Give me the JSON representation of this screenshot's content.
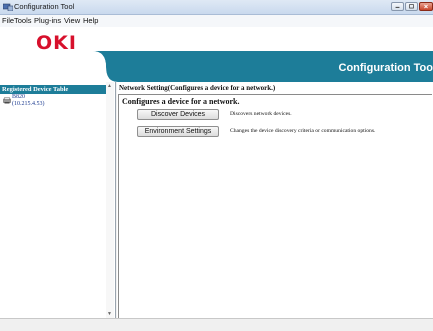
{
  "window": {
    "title": "Configuration Tool"
  },
  "menu": {
    "items": [
      "File",
      "Tools",
      "Plug-ins",
      "View",
      "Help"
    ]
  },
  "header": {
    "logo": "OKI",
    "title": "Configuration Too"
  },
  "sidebar": {
    "heading": "Registered Device Table",
    "devices": [
      {
        "name": "B820",
        "ip": "(10.215.4.53)"
      }
    ]
  },
  "main": {
    "section_title": "Network Setting(Configures a device for a network.)",
    "subtitle": "Configures a device for a network.",
    "actions": [
      {
        "label": "Discover Devices",
        "description": "Discovers network devices."
      },
      {
        "label": "Environment Settings",
        "description": "Changes the device discovery criteria or communication options."
      }
    ]
  },
  "colors": {
    "accent": "#1d7d99",
    "logo": "#d7102c"
  }
}
